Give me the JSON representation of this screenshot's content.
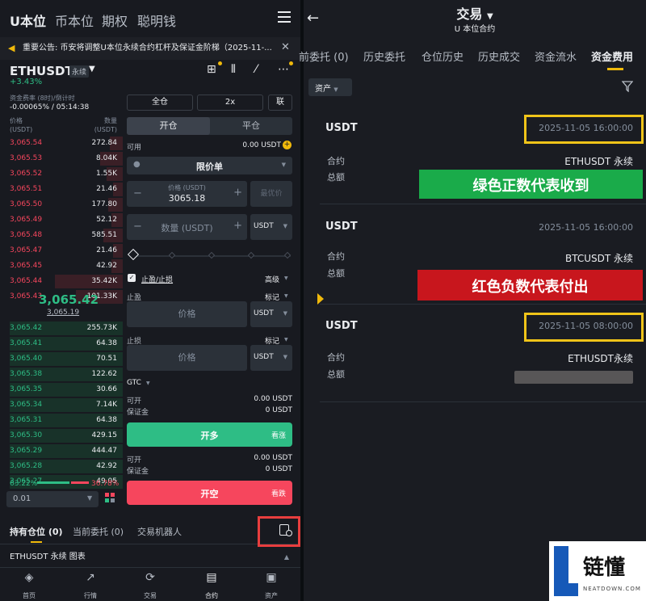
{
  "top_nav": {
    "tabs": [
      "U本位",
      "币本位",
      "期权",
      "聪明钱"
    ]
  },
  "notice": "重要公告: 币安将调整U本位永续合约杠杆及保证金阶梯（2025-11-...",
  "symbol": {
    "name": "ETHUSDT",
    "tag": "永续",
    "change": "+3.43%"
  },
  "funding": {
    "label": "资金费率 (8时)/倒计时",
    "value": "-0.00065% / 05:14:38"
  },
  "orderbook": {
    "h_price": "价格",
    "h_price_unit": "(USDT)",
    "h_qty": "数量",
    "h_qty_unit": "(USDT)",
    "asks": [
      [
        "3,065.54",
        "272.84"
      ],
      [
        "3,065.53",
        "8.04K"
      ],
      [
        "3,065.52",
        "1.55K"
      ],
      [
        "3,065.51",
        "21.46"
      ],
      [
        "3,065.50",
        "177.80"
      ],
      [
        "3,065.49",
        "52.12"
      ],
      [
        "3,065.48",
        "585.51"
      ],
      [
        "3,065.47",
        "21.46"
      ],
      [
        "3,065.45",
        "42.92"
      ],
      [
        "3,065.44",
        "35.42K"
      ],
      [
        "3,065.43",
        "101.33K"
      ]
    ],
    "mid": "3,065.42",
    "mark": "3,065.19",
    "bids": [
      [
        "3,065.42",
        "255.73K"
      ],
      [
        "3,065.41",
        "64.38"
      ],
      [
        "3,065.40",
        "70.51"
      ],
      [
        "3,065.38",
        "122.62"
      ],
      [
        "3,065.35",
        "30.66"
      ],
      [
        "3,065.34",
        "7.14K"
      ],
      [
        "3,065.31",
        "64.38"
      ],
      [
        "3,065.30",
        "429.15"
      ],
      [
        "3,065.29",
        "444.47"
      ],
      [
        "3,065.28",
        "42.92"
      ],
      [
        "3,065.27",
        "49.05"
      ]
    ],
    "buy_ratio": "63.22%",
    "sell_ratio": "36.78%",
    "agg": "0.01"
  },
  "order_form": {
    "margin_mode": "全仓",
    "leverage": "2x",
    "link": "联",
    "open_tab": "开仓",
    "close_tab": "平仓",
    "avail_label": "可用",
    "avail_value": "0.00 USDT",
    "order_type": "限价单",
    "price_label": "价格 (USDT)",
    "price_value": "3065.18",
    "bbo": "最优价",
    "qty_placeholder": "数量 (USDT)",
    "qty_unit": "USDT",
    "tpsl": "止盈/止损",
    "advanced": "高级",
    "tp_label": "止盈",
    "tp_mark": "标记",
    "tp_price": "价格",
    "tp_unit": "USDT",
    "sl_label": "止损",
    "sl_mark": "标记",
    "sl_price": "价格",
    "sl_unit": "USDT",
    "tif": "GTC",
    "can_open": "可开",
    "can_open_val1": "0.00 USDT",
    "margin": "保证金",
    "margin_val1": "0 USDT",
    "long_btn": "开多",
    "long_hint": "看涨",
    "can_open_val2": "0.00 USDT",
    "margin_val2": "0 USDT",
    "short_btn": "开空",
    "short_hint": "看跌"
  },
  "positions": {
    "tabs": [
      "持有仓位 (0)",
      "当前委托 (0)",
      "交易机器人"
    ],
    "sub": "ETHUSDT 永续 图表"
  },
  "bottom_nav": [
    "首页",
    "行情",
    "交易",
    "合约",
    "资产"
  ],
  "right": {
    "title": "交易",
    "subtitle": "U 本位合约",
    "tabs": [
      "前委托 (0)",
      "历史委托",
      "仓位历史",
      "历史成交",
      "资金流水",
      "资金费用"
    ],
    "asset_filter": "资产",
    "records": [
      {
        "currency": "USDT",
        "time": "2025-11-05 16:00:00",
        "k1": "合约",
        "v1": "ETHUSDT 永续",
        "k2": "总额"
      },
      {
        "currency": "USDT",
        "time": "2025-11-05 16:00:00",
        "k1": "合约",
        "v1": "BTCUSDT 永续",
        "k2": "总额"
      },
      {
        "currency": "USDT",
        "time": "2025-11-05 08:00:00",
        "k1": "合约",
        "v1": "ETHUSDT永续",
        "k2": "总额"
      }
    ],
    "ann_green": "绿色正数代表收到",
    "ann_red": "红色负数代表付出"
  },
  "watermark": {
    "cn": "链懂",
    "en": "NEATDOWN.COM"
  },
  "colors": {
    "green": "#2ebd85",
    "red": "#f6465d",
    "yellow": "#f0b90b",
    "ann_green": "#1aab4a",
    "ann_red": "#c8161d"
  }
}
